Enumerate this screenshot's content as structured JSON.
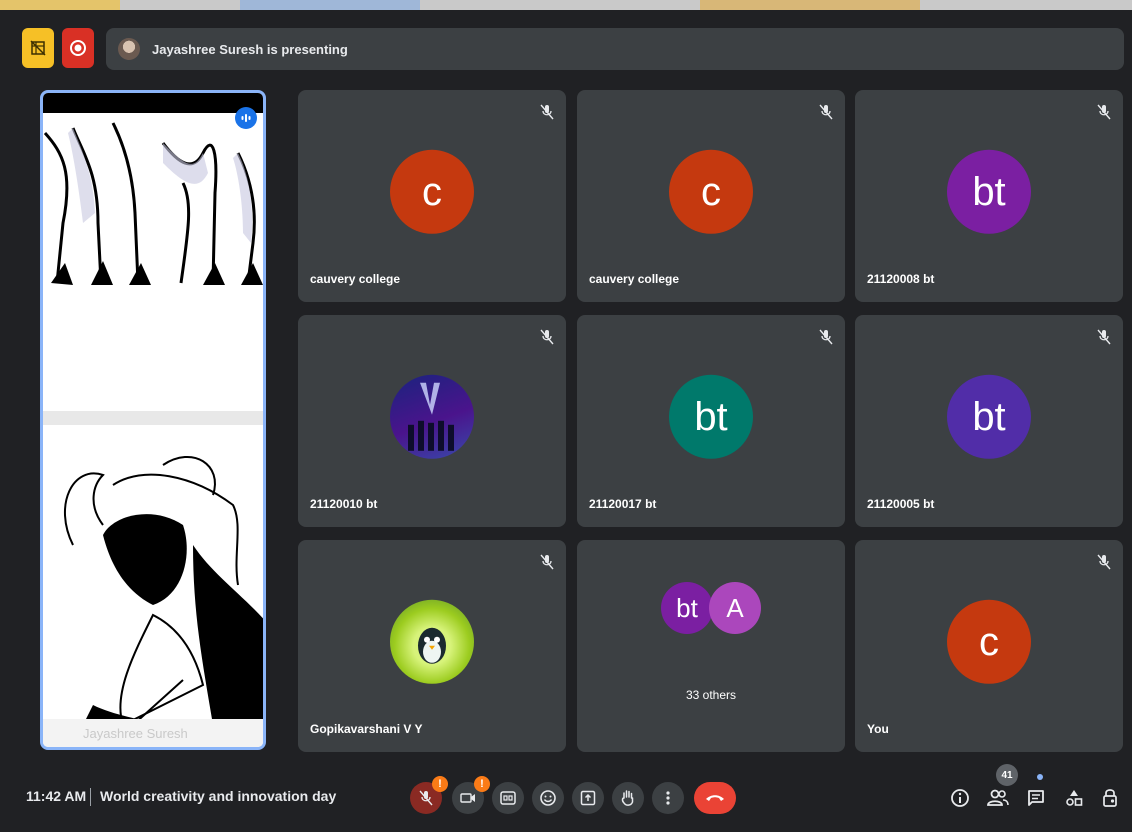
{
  "presenting": {
    "text": "Jayashree Suresh is presenting"
  },
  "presenter": {
    "footer_name": "Jayashree Suresh"
  },
  "tiles": [
    {
      "name": "cauvery college",
      "avatar_text": "c",
      "avatar_color": "#c5390f"
    },
    {
      "name": "cauvery college",
      "avatar_text": "c",
      "avatar_color": "#c5390f"
    },
    {
      "name": "21120008 bt",
      "avatar_text": "bt",
      "avatar_color": "#7b1fa2"
    },
    {
      "name": "21120010 bt",
      "avatar_text": "",
      "avatar_color": "#1a237e"
    },
    {
      "name": "21120017 bt",
      "avatar_text": "bt",
      "avatar_color": "#00796b"
    },
    {
      "name": "21120005 bt",
      "avatar_text": "bt",
      "avatar_color": "#512da8"
    },
    {
      "name": "Gopikavarshani V Y",
      "avatar_text": "",
      "avatar_color": "#9ccc1f"
    },
    {
      "name": "",
      "avatar_text": "",
      "avatar_color": ""
    },
    {
      "name": "You",
      "avatar_text": "c",
      "avatar_color": "#c5390f"
    }
  ],
  "others": {
    "avatar1": "bt",
    "avatar1_color": "#7b1fa2",
    "avatar2": "A",
    "avatar2_color": "#ab47bc",
    "label": "33 others"
  },
  "bottom": {
    "time": "11:42 AM",
    "meeting_title": "World creativity and innovation day",
    "participants_count": "41",
    "warn_mark": "!"
  },
  "colors": {
    "background": "#202124",
    "tile": "#3c4043",
    "accent": "#8ab4f8",
    "end_call": "#ea4335"
  }
}
